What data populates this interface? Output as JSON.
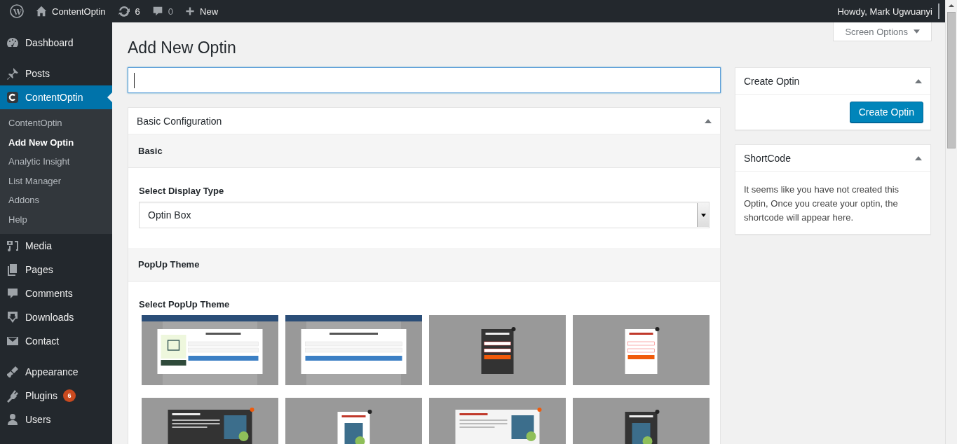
{
  "admin_bar": {
    "site_name": "ContentOptin",
    "updates_count": "6",
    "comments_count": "0",
    "new_label": "New",
    "greeting": "Howdy, Mark Ugwuanyi"
  },
  "sidebar": {
    "items": [
      {
        "label": "Dashboard",
        "selected": false,
        "separator_before": false
      },
      {
        "label": "Posts",
        "selected": false,
        "separator_before": true
      },
      {
        "label": "ContentOptin",
        "selected": true,
        "separator_before": false,
        "children": [
          {
            "label": "ContentOptin",
            "selected": false
          },
          {
            "label": "Add New Optin",
            "selected": true
          },
          {
            "label": "Analytic Insight",
            "selected": false
          },
          {
            "label": "List Manager",
            "selected": false
          },
          {
            "label": "Addons",
            "selected": false
          },
          {
            "label": "Help",
            "selected": false
          }
        ]
      },
      {
        "label": "Media",
        "selected": false,
        "separator_before": false
      },
      {
        "label": "Pages",
        "selected": false,
        "separator_before": false
      },
      {
        "label": "Comments",
        "selected": false,
        "separator_before": false
      },
      {
        "label": "Downloads",
        "selected": false,
        "separator_before": false
      },
      {
        "label": "Contact",
        "selected": false,
        "separator_before": false
      },
      {
        "label": "Appearance",
        "selected": false,
        "separator_before": true
      },
      {
        "label": "Plugins",
        "selected": false,
        "separator_before": false,
        "badge": "6"
      },
      {
        "label": "Users",
        "selected": false,
        "separator_before": false
      }
    ]
  },
  "screen_options": {
    "label": "Screen Options"
  },
  "page_title": "Add New Optin",
  "title_field": {
    "focused": true
  },
  "basic_configuration": {
    "title": "Basic Configuration",
    "expanded": true,
    "sections": [
      {
        "kind": "select",
        "heading": "Basic",
        "label": "Select Display Type",
        "value": "Optin Box"
      },
      {
        "kind": "themes",
        "heading": "PopUp Theme",
        "label": "Select PopUp Theme",
        "themes": [
          {
            "kind": "modal-image"
          },
          {
            "kind": "modal"
          },
          {
            "kind": "dark-narrow"
          },
          {
            "kind": "light-narrow"
          },
          {
            "kind": "dark-wide"
          },
          {
            "kind": "light-narrow-product"
          },
          {
            "kind": "light-wide"
          },
          {
            "kind": "dark-narrow-product"
          }
        ]
      }
    ]
  },
  "side_boxes": [
    {
      "kind": "button",
      "title": "Create Optin",
      "expanded": true,
      "button": "Create Optin"
    },
    {
      "kind": "text",
      "title": "ShortCode",
      "expanded": true,
      "text": "It seems like you have not created this Optin, Once you create your optin, the shortcode will appear here."
    }
  ]
}
